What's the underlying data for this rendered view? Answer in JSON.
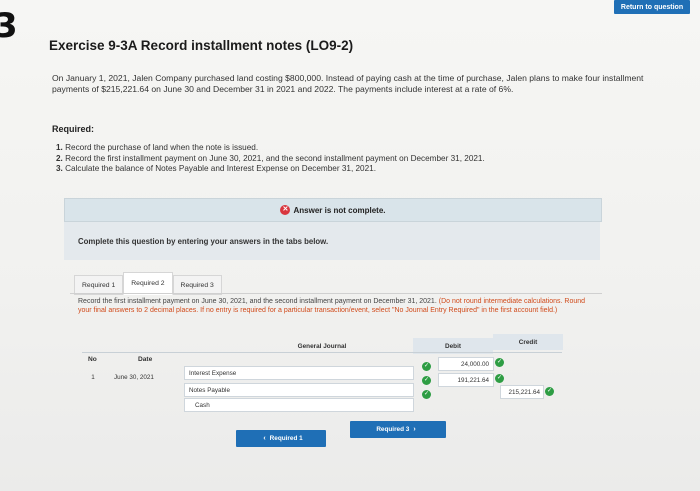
{
  "page_number": "3",
  "header": {
    "return_label": "Return to question"
  },
  "exercise": {
    "title": "Exercise 9-3A Record installment notes (LO9-2)",
    "problem": "On January 1, 2021, Jalen Company purchased land costing $800,000. Instead of paying cash at the time of purchase, Jalen plans to make four installment payments of $215,221.64 on June 30 and December 31 in 2021 and 2022. The payments include interest at a rate of 6%.",
    "required_heading": "Required:",
    "requirements": [
      {
        "num": "1.",
        "text": "Record the purchase of land when the note is issued."
      },
      {
        "num": "2.",
        "text": "Record the first installment payment on June 30, 2021, and the second installment payment on December 31, 2021."
      },
      {
        "num": "3.",
        "text": "Calculate the balance of Notes Payable and Interest Expense on December 31, 2021."
      }
    ]
  },
  "status": {
    "answer_status": "Answer is not complete.",
    "complete_note": "Complete this question by entering your answers in the tabs below."
  },
  "tabs": [
    {
      "label": "Required 1"
    },
    {
      "label": "Required 2"
    },
    {
      "label": "Required 3"
    }
  ],
  "instruction": {
    "text": "Record the first installment payment on June 30, 2021, and the second installment payment on December 31, 2021.",
    "emphasis": "(Do not round intermediate calculations. Round your final answers to 2 decimal places. If no entry is required for a particular transaction/event, select \"No Journal Entry Required\" in the first account field.)"
  },
  "journal": {
    "title": "General Journal",
    "columns": {
      "no": "No",
      "date": "Date",
      "debit": "Debit",
      "credit": "Credit"
    },
    "entry": {
      "no": "1",
      "date": "June 30, 2021",
      "rows": [
        {
          "account": "Interest Expense",
          "debit": "24,000.00",
          "credit": ""
        },
        {
          "account": "Notes Payable",
          "debit": "191,221.64",
          "credit": ""
        },
        {
          "account": "Cash",
          "debit": "",
          "credit": "215,221.64"
        }
      ]
    }
  },
  "navigation": {
    "prev_label": "Required 1",
    "next_label": "Required 3"
  }
}
